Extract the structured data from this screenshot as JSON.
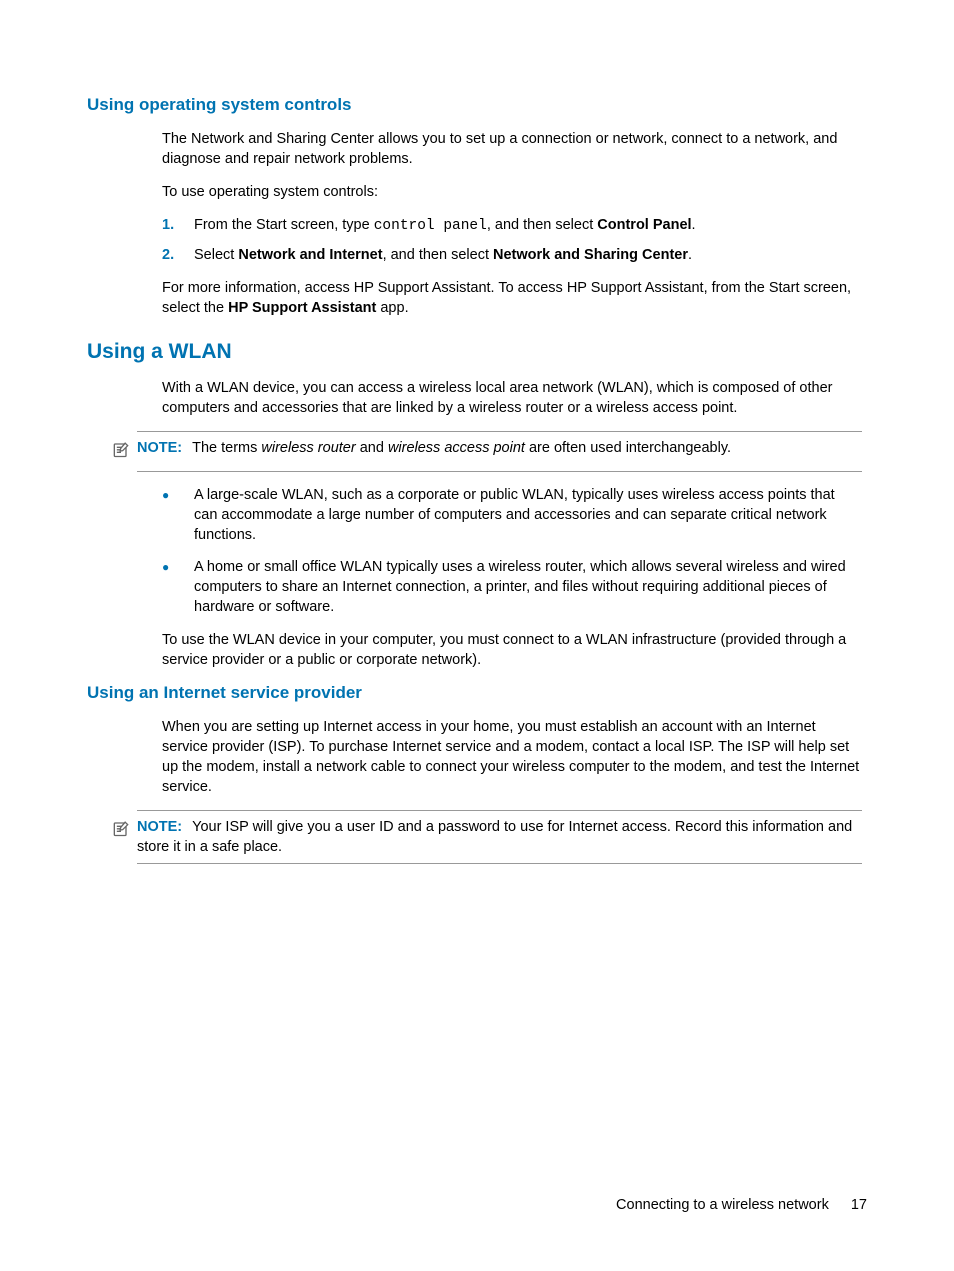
{
  "headings": {
    "os_controls": "Using operating system controls",
    "using_wlan": "Using a WLAN",
    "isp": "Using an Internet service provider"
  },
  "os_controls": {
    "intro": "The Network and Sharing Center allows you to set up a connection or network, connect to a network, and diagnose and repair network problems.",
    "to_use": "To use operating system controls:",
    "step1_a": "From the Start screen, type ",
    "step1_code": "control panel",
    "step1_b": ", and then select ",
    "step1_bold": "Control Panel",
    "step1_c": ".",
    "step2_a": "Select ",
    "step2_bold1": "Network and Internet",
    "step2_b": ", and then select ",
    "step2_bold2": "Network and Sharing Center",
    "step2_c": ".",
    "more_a": "For more information, access HP Support Assistant. To access HP Support Assistant, from the Start screen, select the ",
    "more_bold": "HP Support Assistant",
    "more_b": " app.",
    "markers": {
      "one": "1.",
      "two": "2."
    }
  },
  "wlan": {
    "intro": "With a WLAN device, you can access a wireless local area network (WLAN), which is composed of other computers and accessories that are linked by a wireless router or a wireless access point.",
    "note_label": "NOTE:",
    "note_a": "The terms ",
    "note_i1": "wireless router",
    "note_b": " and ",
    "note_i2": "wireless access point",
    "note_c": " are often used interchangeably.",
    "bullet1": "A large-scale WLAN, such as a corporate or public WLAN, typically uses wireless access points that can accommodate a large number of computers and accessories and can separate critical network functions.",
    "bullet2": "A home or small office WLAN typically uses a wireless router, which allows several wireless and wired computers to share an Internet connection, a printer, and files without requiring additional pieces of hardware or software.",
    "closing": "To use the WLAN device in your computer, you must connect to a WLAN infrastructure (provided through a service provider or a public or corporate network).",
    "bullet_marker": "●"
  },
  "isp": {
    "intro": "When you are setting up Internet access in your home, you must establish an account with an Internet service provider (ISP). To purchase Internet service and a modem, contact a local ISP. The ISP will help set up the modem, install a network cable to connect your wireless computer to the modem, and test the Internet service.",
    "note_label": "NOTE:",
    "note_text": "Your ISP will give you a user ID and a password to use for Internet access. Record this information and store it in a safe place."
  },
  "footer": {
    "section": "Connecting to a wireless network",
    "page": "17"
  }
}
